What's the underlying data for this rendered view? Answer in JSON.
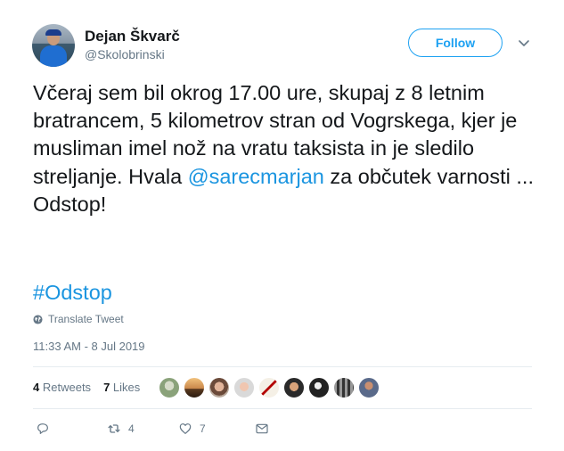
{
  "user": {
    "display_name": "Dejan Škvarč",
    "handle": "@Skolobrinski"
  },
  "follow_label": "Follow",
  "tweet": {
    "text_before": "Včeraj sem bil okrog 17.00 ure, skupaj z 8 letnim bratrancem, 5 kilometrov stran od Vogrskega, kjer je musliman imel nož na vratu taksista in je sledilo streljanje. Hvala ",
    "mention": "@sarecmarjan",
    "text_after": " za občutek varnosti ...\nOdstop!",
    "hashtag": "#Odstop"
  },
  "translate_label": "Translate Tweet",
  "timestamp": "11:33 AM - 8 Jul 2019",
  "stats": {
    "retweets_count": "4",
    "retweets_label": "Retweets",
    "likes_count": "7",
    "likes_label": "Likes"
  },
  "actions": {
    "reply_count": "",
    "retweet_count": "4",
    "like_count": "7"
  },
  "colors": {
    "accent": "#1da1f2",
    "link": "#1b95e0",
    "muted": "#657786"
  },
  "icons": [
    "globe-icon",
    "caret-down-icon",
    "reply-icon",
    "retweet-icon",
    "like-icon",
    "message-icon"
  ]
}
